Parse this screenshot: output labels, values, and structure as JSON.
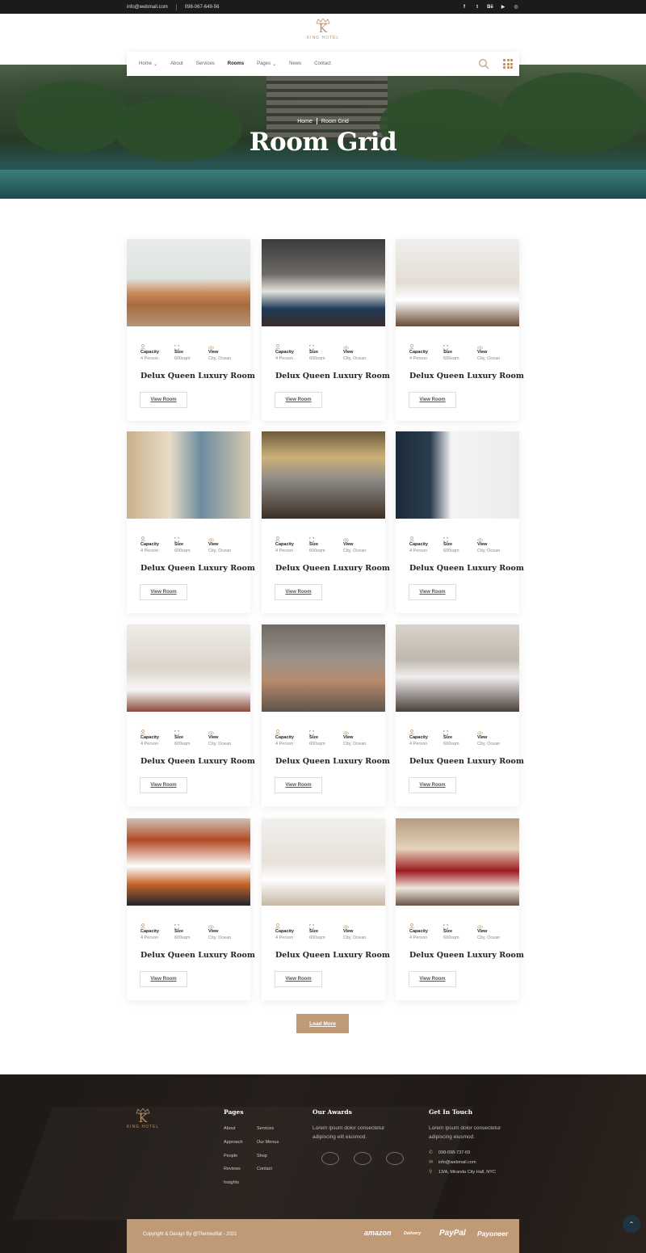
{
  "topbar": {
    "email": "info@webmail.com",
    "phone": "098-067-649-56",
    "social": [
      {
        "icon": "facebook-icon",
        "glyph": "f"
      },
      {
        "icon": "twitter-icon",
        "glyph": "t"
      },
      {
        "icon": "behance-icon",
        "glyph": "Bē"
      },
      {
        "icon": "youtube-icon",
        "glyph": "▶"
      },
      {
        "icon": "instagram-icon",
        "glyph": "◎"
      }
    ]
  },
  "brand": {
    "logo_letter": "K",
    "logo_name": "KING HOTEL",
    "accent": "#b8916a"
  },
  "nav": {
    "items": [
      {
        "label": "Home",
        "dropdown": true,
        "active": false
      },
      {
        "label": "About",
        "dropdown": false,
        "active": false
      },
      {
        "label": "Services",
        "dropdown": false,
        "active": false
      },
      {
        "label": "Rooms",
        "dropdown": false,
        "active": true
      },
      {
        "label": "Pages",
        "dropdown": true,
        "active": false
      },
      {
        "label": "News",
        "dropdown": false,
        "active": false
      },
      {
        "label": "Contact",
        "dropdown": false,
        "active": false
      }
    ]
  },
  "hero": {
    "crumb_home": "Home",
    "crumb_current": "Room Grid",
    "title": "Room Grid"
  },
  "room_spec_labels": {
    "capacity": "Capacity",
    "size": "Size",
    "view": "View"
  },
  "rooms": [
    {
      "title": "Delux Queen Luxury Room",
      "capacity": "4 Person",
      "size": "600sqm",
      "view": "City, Ocean",
      "button": "View Room",
      "photo": "living-room"
    },
    {
      "title": "Delux Queen Luxury Room",
      "capacity": "4 Person",
      "size": "600sqm",
      "view": "City, Ocean",
      "button": "View Room",
      "photo": "bedroom-dark"
    },
    {
      "title": "Delux Queen Luxury Room",
      "capacity": "4 Person",
      "size": "600sqm",
      "view": "City, Ocean",
      "button": "View Room",
      "photo": "bedroom-light"
    },
    {
      "title": "Delux Queen Luxury Room",
      "capacity": "4 Person",
      "size": "600sqm",
      "view": "City, Ocean",
      "button": "View Room",
      "photo": "bedroom-window"
    },
    {
      "title": "Delux Queen Luxury Room",
      "capacity": "4 Person",
      "size": "600sqm",
      "view": "City, Ocean",
      "button": "View Room",
      "photo": "bedroom-gold"
    },
    {
      "title": "Delux Queen Luxury Room",
      "capacity": "4 Person",
      "size": "600sqm",
      "view": "City, Ocean",
      "button": "View Room",
      "photo": "pillows"
    },
    {
      "title": "Delux Queen Luxury Room",
      "capacity": "4 Person",
      "size": "600sqm",
      "view": "City, Ocean",
      "button": "View Room",
      "photo": "bedroom-tv"
    },
    {
      "title": "Delux Queen Luxury Room",
      "capacity": "4 Person",
      "size": "600sqm",
      "view": "City, Ocean",
      "button": "View Room",
      "photo": "suite"
    },
    {
      "title": "Delux Queen Luxury Room",
      "capacity": "4 Person",
      "size": "600sqm",
      "view": "City, Ocean",
      "button": "View Room",
      "photo": "bedroom-headboard"
    },
    {
      "title": "Delux Queen Luxury Room",
      "capacity": "4 Person",
      "size": "600sqm",
      "view": "City, Ocean",
      "button": "View Room",
      "photo": "bedroom-orange"
    },
    {
      "title": "Delux Queen Luxury Room",
      "capacity": "4 Person",
      "size": "600sqm",
      "view": "City, Ocean",
      "button": "View Room",
      "photo": "bedroom-light-2"
    },
    {
      "title": "Delux Queen Luxury Room",
      "capacity": "4 Person",
      "size": "600sqm",
      "view": "City, Ocean",
      "button": "View Room",
      "photo": "bedroom-red"
    }
  ],
  "load_more": "Load More",
  "footer": {
    "pages_title": "Pages",
    "pages_col1": [
      "About",
      "Approach",
      "People",
      "Reviews",
      "Insights"
    ],
    "pages_col2": [
      "Services",
      "Our Menus",
      "Shop",
      "Contact"
    ],
    "awards_title": "Our Awards",
    "awards_text": "Lorem ipsum dolor  consectetur adipiscing elit eiusmod.",
    "contact_title": "Get In Touch",
    "contact_text": "Lorem ipsum dolor  consectetur adipiscing eiusmod.",
    "phone": "098-098-737-69",
    "email": "info@webmail.com",
    "address": "13/A, Miranda City Hall, NYC",
    "copyright": "Copyright & Design By @Themesflat - 2021",
    "brands": [
      "amazon",
      "Delivery",
      "PayPal",
      "Payoneer"
    ],
    "brand_color": "#c09a77"
  }
}
